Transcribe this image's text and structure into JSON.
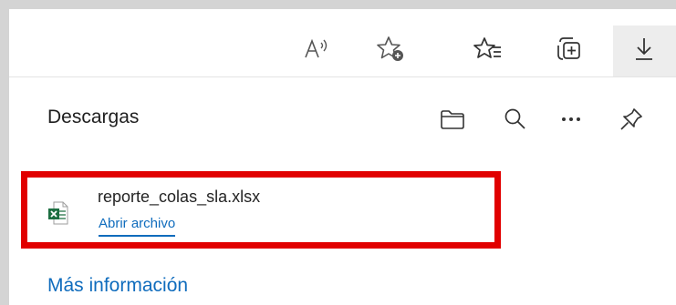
{
  "toolbar": {
    "icons": [
      "read-aloud-icon",
      "add-favorite-icon",
      "favorites-icon",
      "collections-icon",
      "downloads-icon"
    ],
    "active_icon": "downloads-icon"
  },
  "downloads_panel": {
    "title": "Descargas",
    "header_icons": [
      "folder-icon",
      "search-icon",
      "more-icon",
      "pin-icon"
    ],
    "items": [
      {
        "file_name": "reporte_colas_sla.xlsx",
        "file_icon": "excel-file-icon",
        "action_label": "Abrir archivo"
      }
    ],
    "more_info_label": "Más información"
  },
  "colors": {
    "link": "#0f6cbd",
    "highlight_border": "#e10000",
    "excel_green": "#1d6f42"
  }
}
